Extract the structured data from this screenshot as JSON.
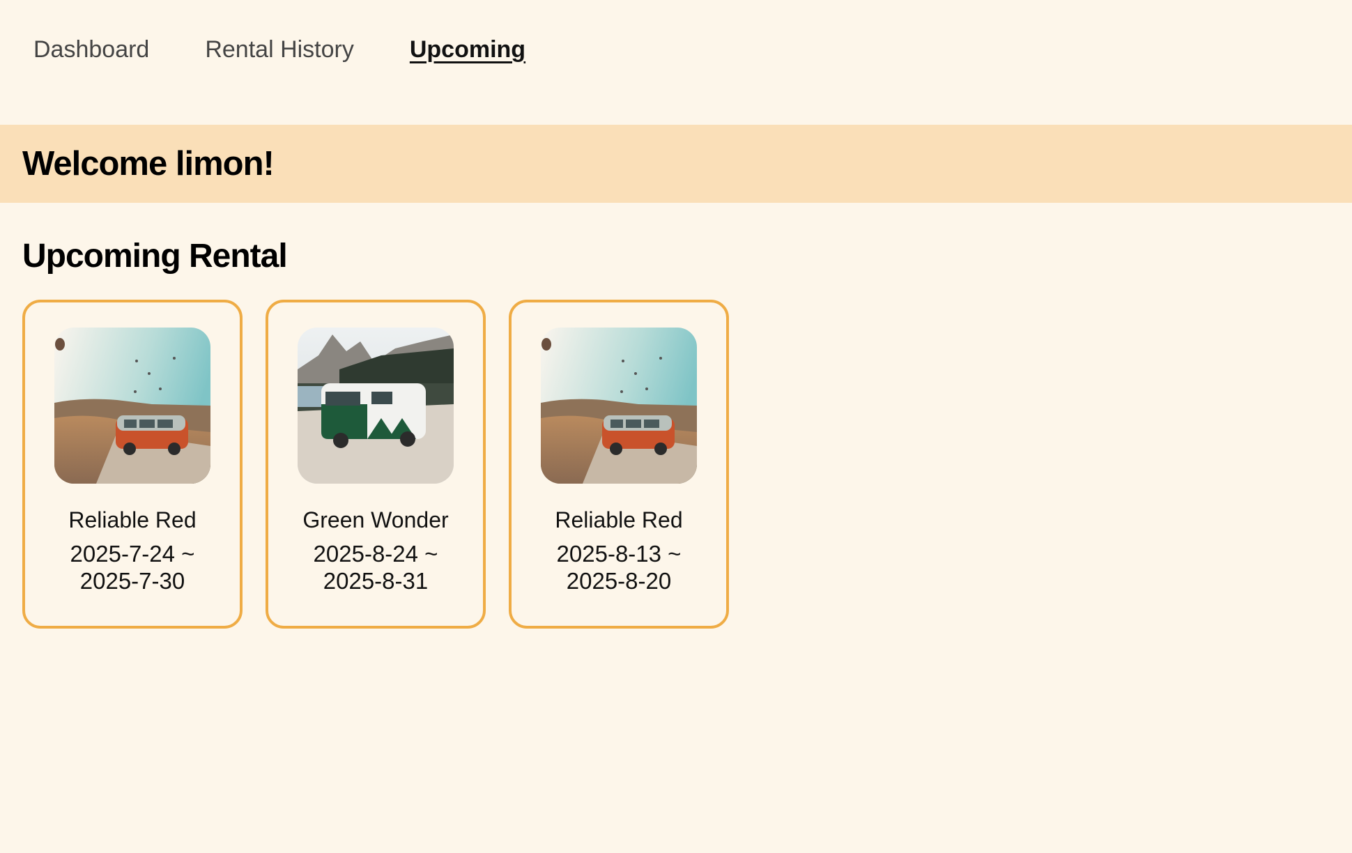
{
  "nav": {
    "items": [
      {
        "label": "Dashboard",
        "active": false
      },
      {
        "label": "Rental History",
        "active": false
      },
      {
        "label": "Upcoming",
        "active": true
      }
    ]
  },
  "welcome": {
    "text": "Welcome limon!"
  },
  "upcoming": {
    "title": "Upcoming Rental",
    "rentals": [
      {
        "name": "Reliable Red",
        "start": "2025-7-24 ~",
        "end": "2025-7-30",
        "image": "red-van-photo"
      },
      {
        "name": "Green Wonder",
        "start": "2025-8-24 ~",
        "end": "2025-8-31",
        "image": "green-van-photo"
      },
      {
        "name": "Reliable Red",
        "start": "2025-8-13 ~",
        "end": "2025-8-20",
        "image": "red-van-photo"
      }
    ]
  },
  "colors": {
    "background": "#fdf6ea",
    "welcome_band": "#fadfb8",
    "card_border": "#efac45"
  }
}
